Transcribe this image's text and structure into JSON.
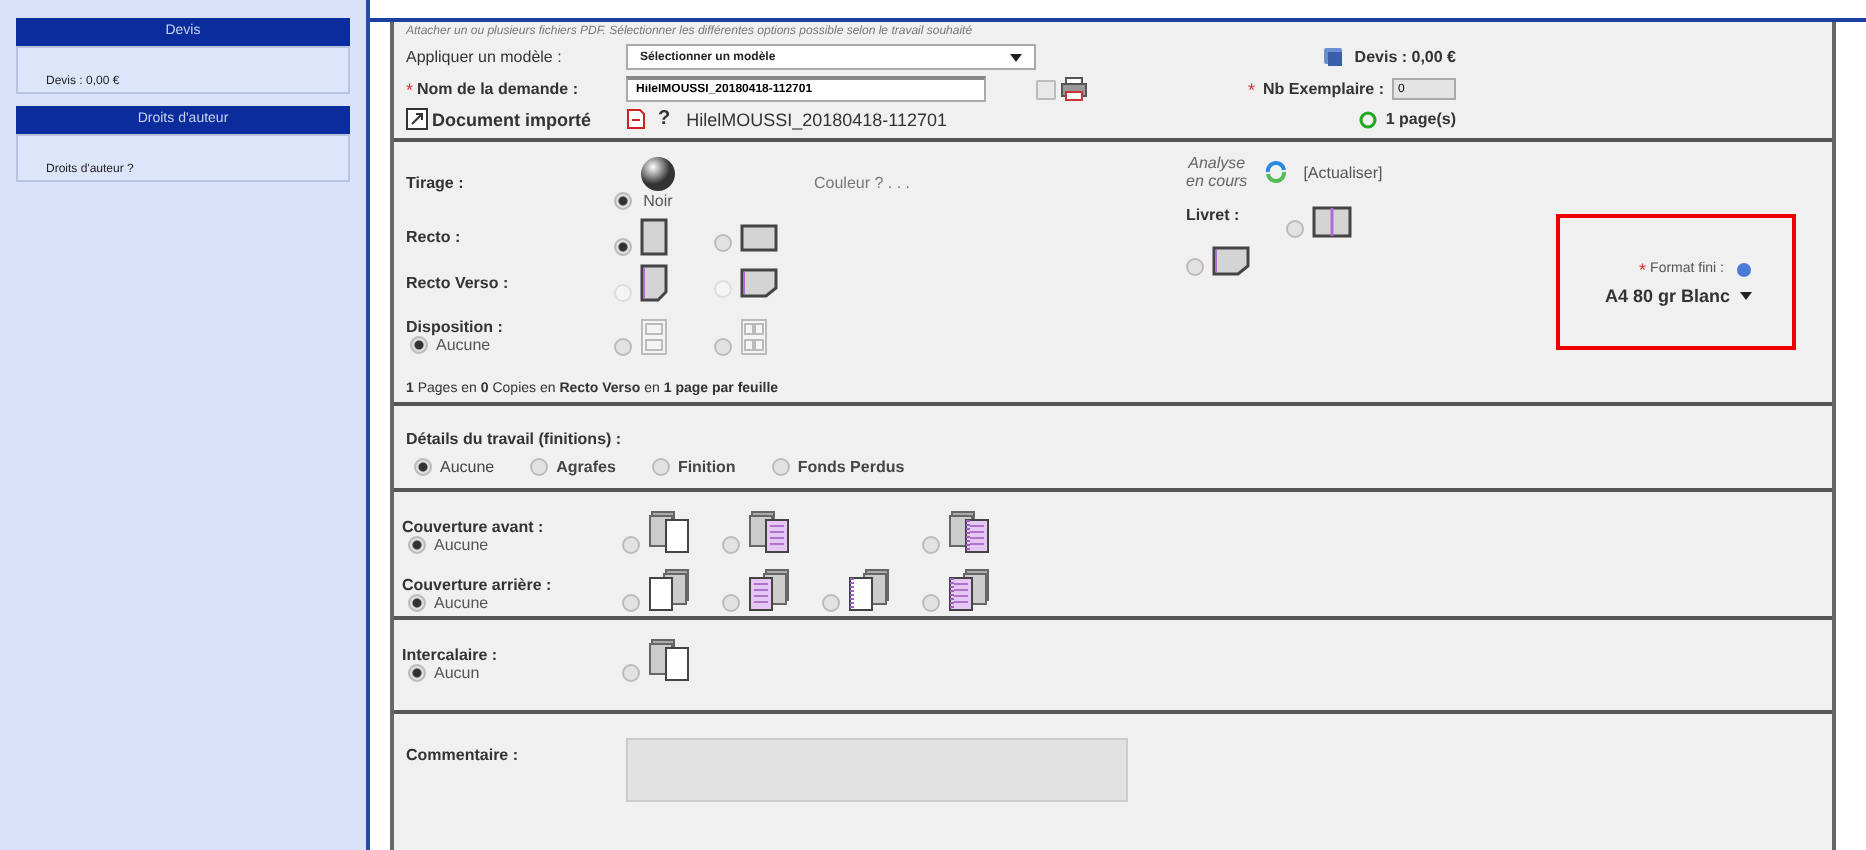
{
  "sidebar": [
    {
      "title": "Devis",
      "items": [
        "Devis : 0,00 €"
      ]
    },
    {
      "title": "Droits d'auteur",
      "items": [
        "Droits d'auteur ?"
      ]
    }
  ],
  "header": {
    "hint": "Attacher un ou plusieurs fichiers PDF. Sélectionner les différentes options possible selon le travail souhaité",
    "model_label": "Appliquer un modèle :",
    "model_select": "Sélectionner un modèle",
    "name_label": "Nom de la demande :",
    "name_required_mark": "*",
    "name_value": "HilelMOUSSI_20180418-112701",
    "print_checked": false,
    "devis": "Devis : 0,00 €",
    "copies_label": "Nb Exemplaire :",
    "copies_required_mark": "*",
    "copies_value": "0",
    "document_label": "Document importé",
    "help_mark": "?",
    "document_name": "HilelMOUSSI_20180418-112701",
    "pages": "1 page(s)"
  },
  "options": {
    "rows": [
      {
        "label": "Tirage :",
        "choices": [
          {
            "kind": "sphere",
            "caption": "Noir",
            "selected": true,
            "disabled": false
          }
        ],
        "note": "Couleur ? . . ."
      },
      {
        "label": "Recto :",
        "choices": [
          {
            "kind": "portrait",
            "selected": true,
            "disabled": false
          },
          {
            "kind": "landscape",
            "selected": false,
            "disabled": false
          }
        ]
      },
      {
        "label": "Recto Verso :",
        "choices": [
          {
            "kind": "portrait-fold",
            "selected": false,
            "disabled": true
          },
          {
            "kind": "landscape-fold",
            "selected": false,
            "disabled": true
          }
        ]
      },
      {
        "label": "Disposition :",
        "default": {
          "label": "Aucune",
          "selected": true
        },
        "choices": [
          {
            "kind": "two-up",
            "selected": false,
            "disabled": false
          },
          {
            "kind": "four-up",
            "selected": false,
            "disabled": false
          }
        ]
      }
    ],
    "analysis": {
      "status_line_1": "Analyse",
      "status_line_2": "en cours",
      "refresh": "[Actualiser]"
    },
    "booklet": {
      "label": "Livret :",
      "choices": [
        {
          "kind": "book",
          "selected": false,
          "disabled": false
        },
        {
          "kind": "landscape-fold",
          "selected": false,
          "disabled": false
        }
      ]
    },
    "format": {
      "label": "Format fini :",
      "required_mark": "*",
      "value": "A4 80 gr Blanc",
      "highlighted": true
    },
    "summary": "**1** Pages en **0** Copies en **Recto Verso** en **1 page par feuille**"
  },
  "details": {
    "label": "Détails du travail (finitions) :",
    "choices": [
      {
        "label": "Aucune",
        "selected": true,
        "bold": false
      },
      {
        "label": "Agrafes",
        "selected": false,
        "bold": true
      },
      {
        "label": "Finition",
        "selected": false,
        "bold": true
      },
      {
        "label": "Fonds Perdus",
        "selected": false,
        "bold": true
      }
    ]
  },
  "covers": [
    {
      "label": "Couverture avant :",
      "default": {
        "label": "Aucune",
        "selected": true
      },
      "kind": "front",
      "choices": [
        {
          "kind": "plain",
          "selected": false
        },
        {
          "kind": "lined",
          "selected": false
        },
        {
          "kind": "bound-lined",
          "selected": false
        }
      ]
    },
    {
      "label": "Couverture arrière :",
      "default": {
        "label": "Aucune",
        "selected": true
      },
      "kind": "back",
      "choices": [
        {
          "kind": "plain",
          "selected": false
        },
        {
          "kind": "lined",
          "selected": false
        },
        {
          "kind": "bound",
          "selected": false
        },
        {
          "kind": "bound-lined",
          "selected": false
        }
      ]
    },
    {
      "label": "Intercalaire :",
      "default": {
        "label": "Aucun",
        "selected": true
      },
      "kind": "insert",
      "choices": [
        {
          "kind": "plain",
          "selected": false
        }
      ]
    }
  ],
  "comment": {
    "label": "Commentaire :"
  }
}
